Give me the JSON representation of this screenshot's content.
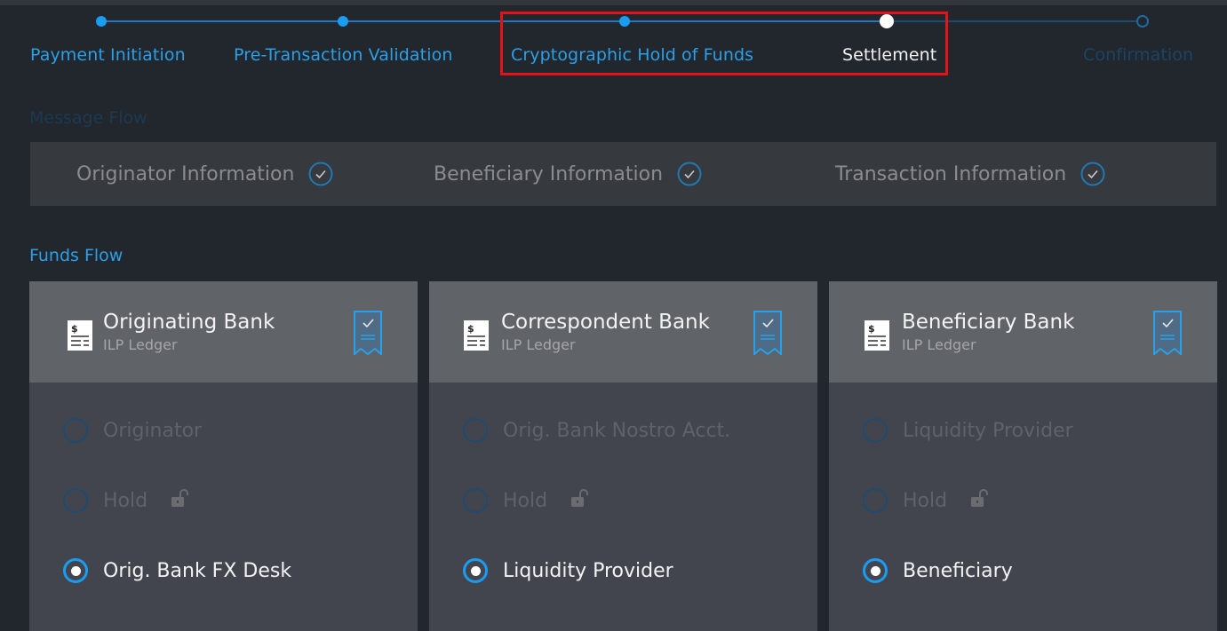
{
  "stepper": {
    "steps": [
      {
        "label": "Payment Initiation",
        "state": "done"
      },
      {
        "label": "Pre-Transaction Validation",
        "state": "done"
      },
      {
        "label": "Cryptographic Hold of Funds",
        "state": "done"
      },
      {
        "label": "Settlement",
        "state": "current"
      },
      {
        "label": "Confirmation",
        "state": "todo"
      }
    ],
    "highlighted_steps": [
      "Cryptographic Hold of Funds",
      "Settlement"
    ]
  },
  "message_flow": {
    "title": "Message Flow",
    "items": [
      {
        "label": "Originator Information",
        "icon": "check-circle-icon",
        "complete": true
      },
      {
        "label": "Beneficiary Information",
        "icon": "check-circle-icon",
        "complete": true
      },
      {
        "label": "Transaction Information",
        "icon": "check-circle-icon",
        "complete": true
      }
    ]
  },
  "funds_flow": {
    "title": "Funds Flow",
    "cards": [
      {
        "bank": "Originating Bank",
        "subtitle": "ILP Ledger",
        "icons": {
          "left": "ledger-icon",
          "right": "ribbon-check-icon"
        },
        "options": [
          {
            "label": "Originator",
            "selected": false
          },
          {
            "label": "Hold",
            "selected": false,
            "icon": "unlock-icon"
          },
          {
            "label": "Orig. Bank FX Desk",
            "selected": true
          }
        ]
      },
      {
        "bank": "Correspondent Bank",
        "subtitle": "ILP Ledger",
        "icons": {
          "left": "ledger-icon",
          "right": "ribbon-check-icon"
        },
        "options": [
          {
            "label": "Orig. Bank Nostro Acct.",
            "selected": false
          },
          {
            "label": "Hold",
            "selected": false,
            "icon": "unlock-icon"
          },
          {
            "label": "Liquidity Provider",
            "selected": true
          }
        ]
      },
      {
        "bank": "Beneficiary Bank",
        "subtitle": "ILP Ledger",
        "icons": {
          "left": "ledger-icon",
          "right": "ribbon-check-icon"
        },
        "options": [
          {
            "label": "Liquidity Provider",
            "selected": false
          },
          {
            "label": "Hold",
            "selected": false,
            "icon": "unlock-icon"
          },
          {
            "label": "Beneficiary",
            "selected": true
          }
        ]
      }
    ]
  },
  "colors": {
    "accent": "#1a9cf2",
    "background": "#22262d",
    "highlight_box": "#e3131a"
  }
}
